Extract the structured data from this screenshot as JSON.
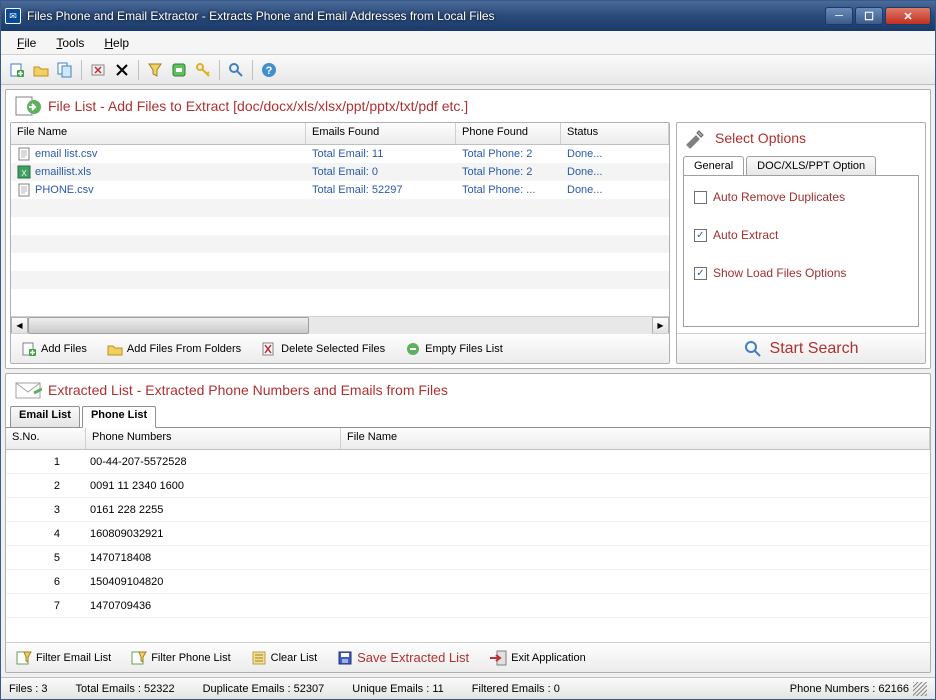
{
  "title": "Files Phone and Email Extractor  -  Extracts Phone and Email Addresses from Local Files",
  "menu": {
    "file": "File",
    "tools": "Tools",
    "help": "Help"
  },
  "fileListPanel": {
    "title": "File List - Add Files to Extract  [doc/docx/xls/xlsx/ppt/pptx/txt/pdf etc.]",
    "columns": {
      "name": "File Name",
      "emails": "Emails Found",
      "phone": "Phone Found",
      "status": "Status"
    },
    "rows": [
      {
        "name": "email list.csv",
        "emails": "Total Email: 11",
        "phone": "Total Phone: 2",
        "status": "Done..."
      },
      {
        "name": "emaillist.xls",
        "emails": "Total Email: 0",
        "phone": "Total Phone: 2",
        "status": "Done..."
      },
      {
        "name": "PHONE.csv",
        "emails": "Total Email: 52297",
        "phone": "Total Phone: ...",
        "status": "Done..."
      }
    ],
    "buttons": {
      "addFiles": "Add Files",
      "addFolders": "Add Files From Folders",
      "deleteSel": "Delete Selected Files",
      "empty": "Empty Files List"
    }
  },
  "options": {
    "title": "Select Options",
    "tabs": {
      "general": "General",
      "doc": "DOC/XLS/PPT Option"
    },
    "autoRemoveDup": "Auto Remove Duplicates",
    "autoExtract": "Auto Extract",
    "showLoad": "Show Load Files Options",
    "startSearch": "Start Search"
  },
  "extracted": {
    "title": "Extracted List - Extracted Phone Numbers and Emails from Files",
    "tabs": {
      "email": "Email List",
      "phone": "Phone List"
    },
    "columns": {
      "sno": "S.No.",
      "phone": "Phone Numbers",
      "file": "File Name"
    },
    "rows": [
      {
        "sno": "1",
        "phone": "00-44-207-5572528",
        "file": ""
      },
      {
        "sno": "2",
        "phone": "0091 11 2340 1600",
        "file": ""
      },
      {
        "sno": "3",
        "phone": "0161 228 2255",
        "file": ""
      },
      {
        "sno": "4",
        "phone": "160809032921",
        "file": ""
      },
      {
        "sno": "5",
        "phone": "1470718408",
        "file": ""
      },
      {
        "sno": "6",
        "phone": "150409104820",
        "file": ""
      },
      {
        "sno": "7",
        "phone": "1470709436",
        "file": ""
      }
    ],
    "buttons": {
      "filterEmail": "Filter Email List",
      "filterPhone": "Filter Phone List",
      "clear": "Clear List",
      "save": "Save Extracted List",
      "exit": "Exit Application"
    }
  },
  "status": {
    "files": "Files :  3",
    "totalEmails": "Total Emails :  52322",
    "dupEmails": "Duplicate Emails :  52307",
    "uniqueEmails": "Unique Emails :  11",
    "filteredEmails": "Filtered Emails :  0",
    "phoneNumbers": "Phone Numbers :  62166"
  }
}
